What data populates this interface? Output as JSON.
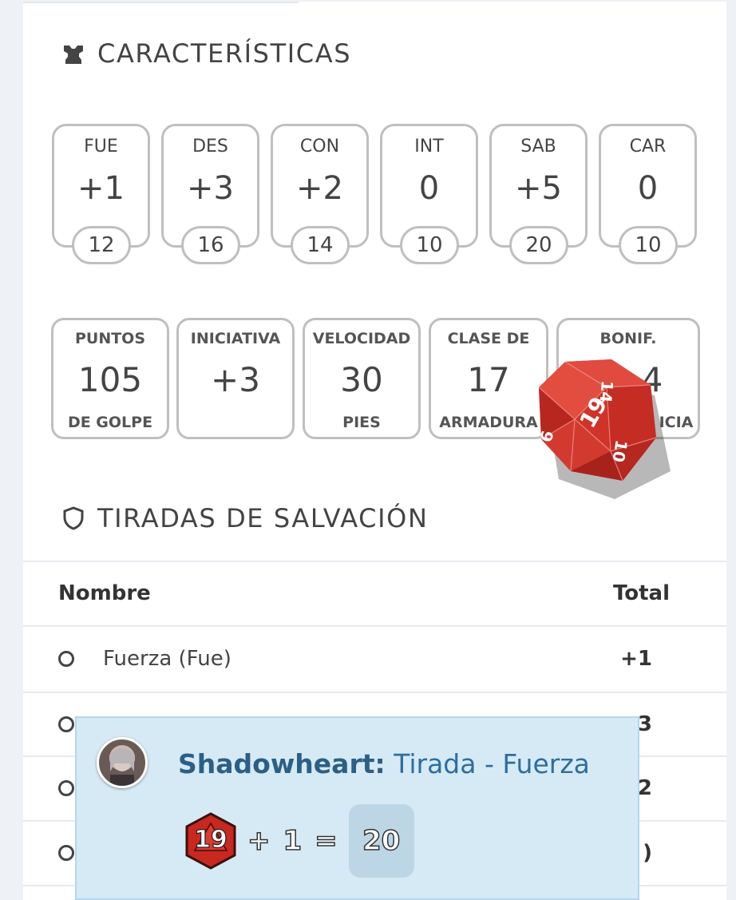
{
  "sections": {
    "abilities_title": "CARACTERÍSTICAS",
    "saves_title": "TIRADAS DE SALVACIÓN"
  },
  "abilities": [
    {
      "abbr": "FUE",
      "mod": "+1",
      "score": "12"
    },
    {
      "abbr": "DES",
      "mod": "+3",
      "score": "16"
    },
    {
      "abbr": "CON",
      "mod": "+2",
      "score": "14"
    },
    {
      "abbr": "INT",
      "mod": "0",
      "score": "10"
    },
    {
      "abbr": "SAB",
      "mod": "+5",
      "score": "20"
    },
    {
      "abbr": "CAR",
      "mod": "0",
      "score": "10"
    }
  ],
  "stats": [
    {
      "top": "PUNTOS",
      "value": "105",
      "bottom": "DE GOLPE"
    },
    {
      "top": "INICIATIVA",
      "value": "+3",
      "bottom": ""
    },
    {
      "top": "VELOCIDAD",
      "value": "30",
      "bottom": "PIES"
    },
    {
      "top": "CLASE DE",
      "value": "17",
      "bottom": "ARMADURA"
    },
    {
      "top": "BONIF.",
      "value": "4",
      "bottom": "ICIA"
    }
  ],
  "saves_table": {
    "headers": {
      "name": "Nombre",
      "total": "Total"
    },
    "rows": [
      {
        "name": "Fuerza (Fue)",
        "total": "+1"
      },
      {
        "name": "",
        "total": "3"
      },
      {
        "name": "",
        "total": "2"
      },
      {
        "name": "",
        "total": ")"
      }
    ]
  },
  "roll_toast": {
    "character": "Shadowheart:",
    "action": "Tirada - Fuerza",
    "die_result": "19",
    "operator": "+",
    "modifier": "1",
    "equals": "=",
    "total": "20"
  },
  "rolling_die": {
    "faces": [
      "19",
      "14",
      "6",
      "10"
    ]
  },
  "colors": {
    "die_red": "#d7352b",
    "toast_bg": "#d6eaf5",
    "toast_title": "#2d6ea0",
    "border_gray": "#bfbfbf"
  }
}
